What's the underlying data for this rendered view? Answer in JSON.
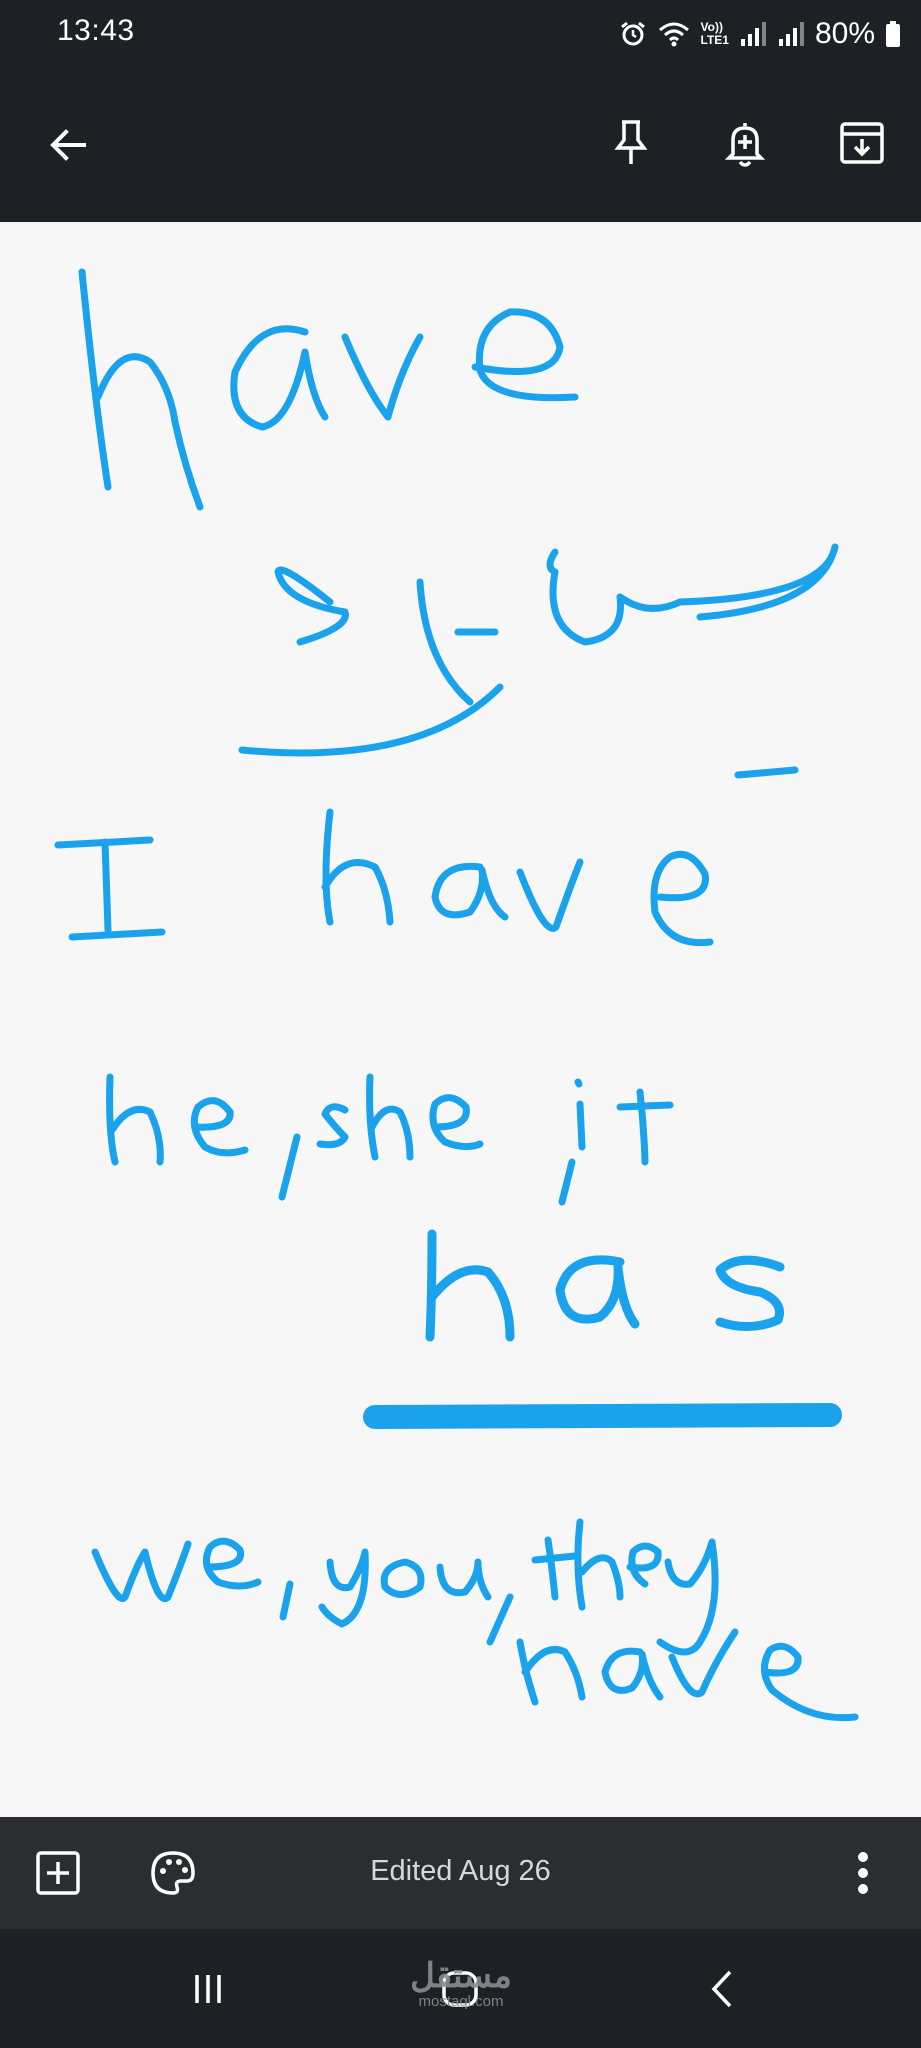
{
  "status": {
    "time": "13:43",
    "network_label_top": "Vo))",
    "network_label_bottom": "LTE1",
    "battery": "80%"
  },
  "toolbar": {
    "icons": [
      "back-arrow-icon",
      "pin-icon",
      "reminder-bell-icon",
      "archive-icon"
    ]
  },
  "note": {
    "type": "handwritten-drawing",
    "ink_color": "#1aa3ec",
    "lines": [
      "have",
      "يمتلك",
      "I have",
      "he, she, it",
      "has",
      "we, you, they",
      "have"
    ]
  },
  "bottom_bar": {
    "edited_label": "Edited Aug 26",
    "icons": [
      "add-box-icon",
      "palette-icon",
      "more-vert-icon"
    ]
  },
  "nav": {
    "icons": [
      "recents-icon",
      "home-icon",
      "back-icon"
    ],
    "watermark_logo": "مستقل",
    "watermark_url": "mostaql.com"
  }
}
